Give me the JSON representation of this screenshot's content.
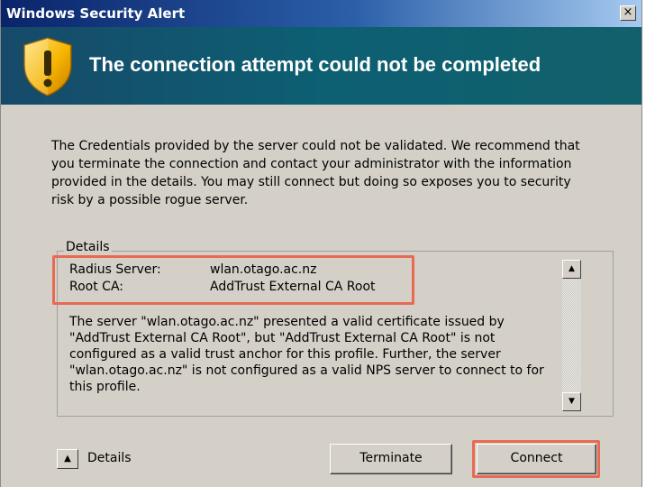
{
  "window": {
    "title": "Windows Security Alert",
    "close_glyph": "×"
  },
  "banner": {
    "icon": "warning-shield-icon",
    "heading": "The connection attempt could not be completed"
  },
  "message": "The Credentials provided by the server could not be validated. We recommend that you terminate the connection and contact your administrator with the information provided in the details. You may still connect but doing so exposes you to security risk by a possible rogue server.",
  "details": {
    "group_label": "Details",
    "fields": [
      {
        "label": "Radius Server:",
        "value": "wlan.otago.ac.nz"
      },
      {
        "label": "Root CA:",
        "value": "AddTrust External CA Root"
      }
    ],
    "explanation": "The server \"wlan.otago.ac.nz\" presented a valid certificate issued by \"AddTrust External CA Root\", but \"AddTrust External CA Root\" is not configured as a valid trust anchor for this profile. Further, the server \"wlan.otago.ac.nz\" is not configured as a valid NPS server to connect to for this profile."
  },
  "footer": {
    "details_toggle_label": "Details",
    "terminate_label": "Terminate",
    "connect_label": "Connect"
  },
  "colors": {
    "highlight": "#e86a52",
    "banner": "#0d5f72",
    "titlebar": "#0a246a"
  }
}
